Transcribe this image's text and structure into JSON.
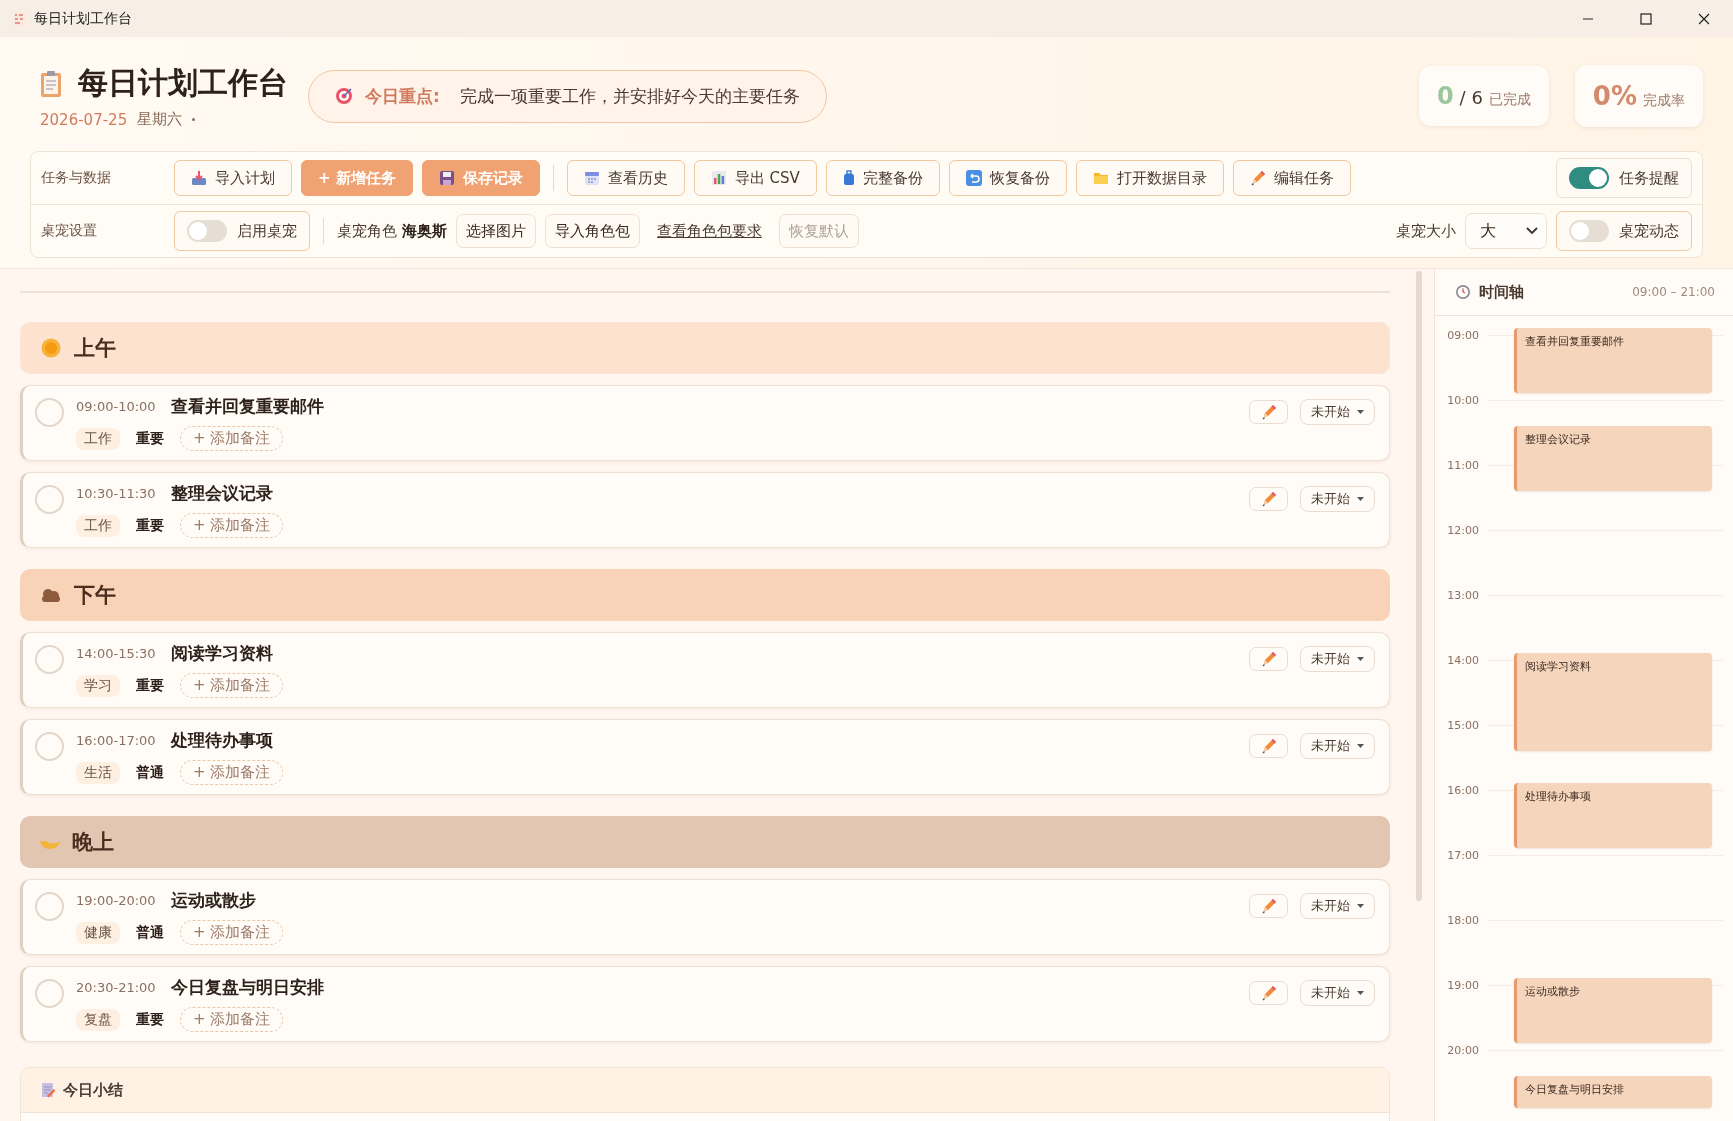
{
  "window": {
    "title": "每日计划工作台"
  },
  "header": {
    "title": "每日计划工作台",
    "date": "2026-07-25",
    "weekday": "星期六",
    "focus_label": "今日重点:",
    "focus_text": "完成一项重要工作，并安排好今天的主要任务",
    "stats": [
      {
        "kind": "count",
        "done": "0",
        "total": "/ 6",
        "caption": "已完成"
      },
      {
        "kind": "rate",
        "value": "0%",
        "caption": "完成率"
      }
    ]
  },
  "toolbar": {
    "rows": [
      {
        "label": "任务与数据",
        "items": [
          {
            "kind": "button",
            "label": "导入计划",
            "primary": false
          },
          {
            "kind": "button",
            "label": "+ 新增任务",
            "primary": true
          },
          {
            "kind": "button",
            "label": "保存记录",
            "primary": true
          },
          {
            "kind": "separator"
          },
          {
            "kind": "button",
            "label": "查看历史",
            "primary": false
          },
          {
            "kind": "button",
            "label": "导出 CSV",
            "primary": false
          },
          {
            "kind": "button",
            "label": "完整备份",
            "primary": false
          },
          {
            "kind": "button",
            "label": "恢复备份",
            "primary": false
          },
          {
            "kind": "button",
            "label": "打开数据目录",
            "primary": false
          },
          {
            "kind": "button",
            "label": "编辑任务",
            "primary": false
          },
          {
            "kind": "spacer"
          },
          {
            "kind": "toggle",
            "label": "任务提醒",
            "on": true
          }
        ]
      },
      {
        "label": "桌宠设置",
        "items": [
          {
            "kind": "toggle",
            "label": "启用桌宠",
            "on": false
          },
          {
            "kind": "separator"
          },
          {
            "kind": "text",
            "label": "桌宠角色"
          },
          {
            "kind": "strong",
            "label": "海奥斯"
          },
          {
            "kind": "chip",
            "label": "选择图片",
            "disabled": false
          },
          {
            "kind": "chip",
            "label": "导入角色包",
            "disabled": false
          },
          {
            "kind": "link",
            "label": "查看角色包要求"
          },
          {
            "kind": "chip",
            "label": "恢复默认",
            "disabled": true
          },
          {
            "kind": "spacer"
          },
          {
            "kind": "text",
            "label": "桌宠大小"
          },
          {
            "kind": "select",
            "value": "大"
          },
          {
            "kind": "toggle",
            "label": "桌宠动态",
            "on": false
          }
        ]
      }
    ]
  },
  "sections": [
    {
      "title": "上午",
      "kind": "morning",
      "color": "#fde3cf",
      "tasks": [
        {
          "time": "09:00-10:00",
          "title": "查看并回复重要邮件",
          "category": "工作",
          "priority": "重要",
          "note_button": "+ 添加备注",
          "status": "未开始",
          "done": false
        },
        {
          "time": "10:30-11:30",
          "title": "整理会议记录",
          "category": "工作",
          "priority": "重要",
          "note_button": "+ 添加备注",
          "status": "未开始",
          "done": false
        }
      ]
    },
    {
      "title": "下午",
      "kind": "afternoon",
      "color": "#f9d3b8",
      "tasks": [
        {
          "time": "14:00-15:30",
          "title": "阅读学习资料",
          "category": "学习",
          "priority": "重要",
          "note_button": "+ 添加备注",
          "status": "未开始",
          "done": false
        },
        {
          "time": "16:00-17:00",
          "title": "处理待办事项",
          "category": "生活",
          "priority": "普通",
          "note_button": "+ 添加备注",
          "status": "未开始",
          "done": false
        }
      ]
    },
    {
      "title": "晚上",
      "kind": "evening",
      "color": "#e2c6b1",
      "tasks": [
        {
          "time": "19:00-20:00",
          "title": "运动或散步",
          "category": "健康",
          "priority": "普通",
          "note_button": "+ 添加备注",
          "status": "未开始",
          "done": false
        },
        {
          "time": "20:30-21:00",
          "title": "今日复盘与明日安排",
          "category": "复盘",
          "priority": "重要",
          "note_button": "+ 添加备注",
          "status": "未开始",
          "done": false
        }
      ]
    }
  ],
  "summary": {
    "title": "今日小结"
  },
  "timeline": {
    "title": "时间轴",
    "range": "09:00 – 21:00",
    "hours": [
      "09:00",
      "10:00",
      "11:00",
      "12:00",
      "13:00",
      "14:00",
      "15:00",
      "16:00",
      "17:00",
      "18:00",
      "19:00",
      "20:00"
    ],
    "events": [
      {
        "label": "查看并回复重要邮件"
      },
      {
        "label": "整理会议记录"
      },
      {
        "label": "阅读学习资料"
      },
      {
        "label": "处理待办事项"
      },
      {
        "label": "运动或散步"
      },
      {
        "label": "今日复盘与明日安排"
      }
    ]
  }
}
